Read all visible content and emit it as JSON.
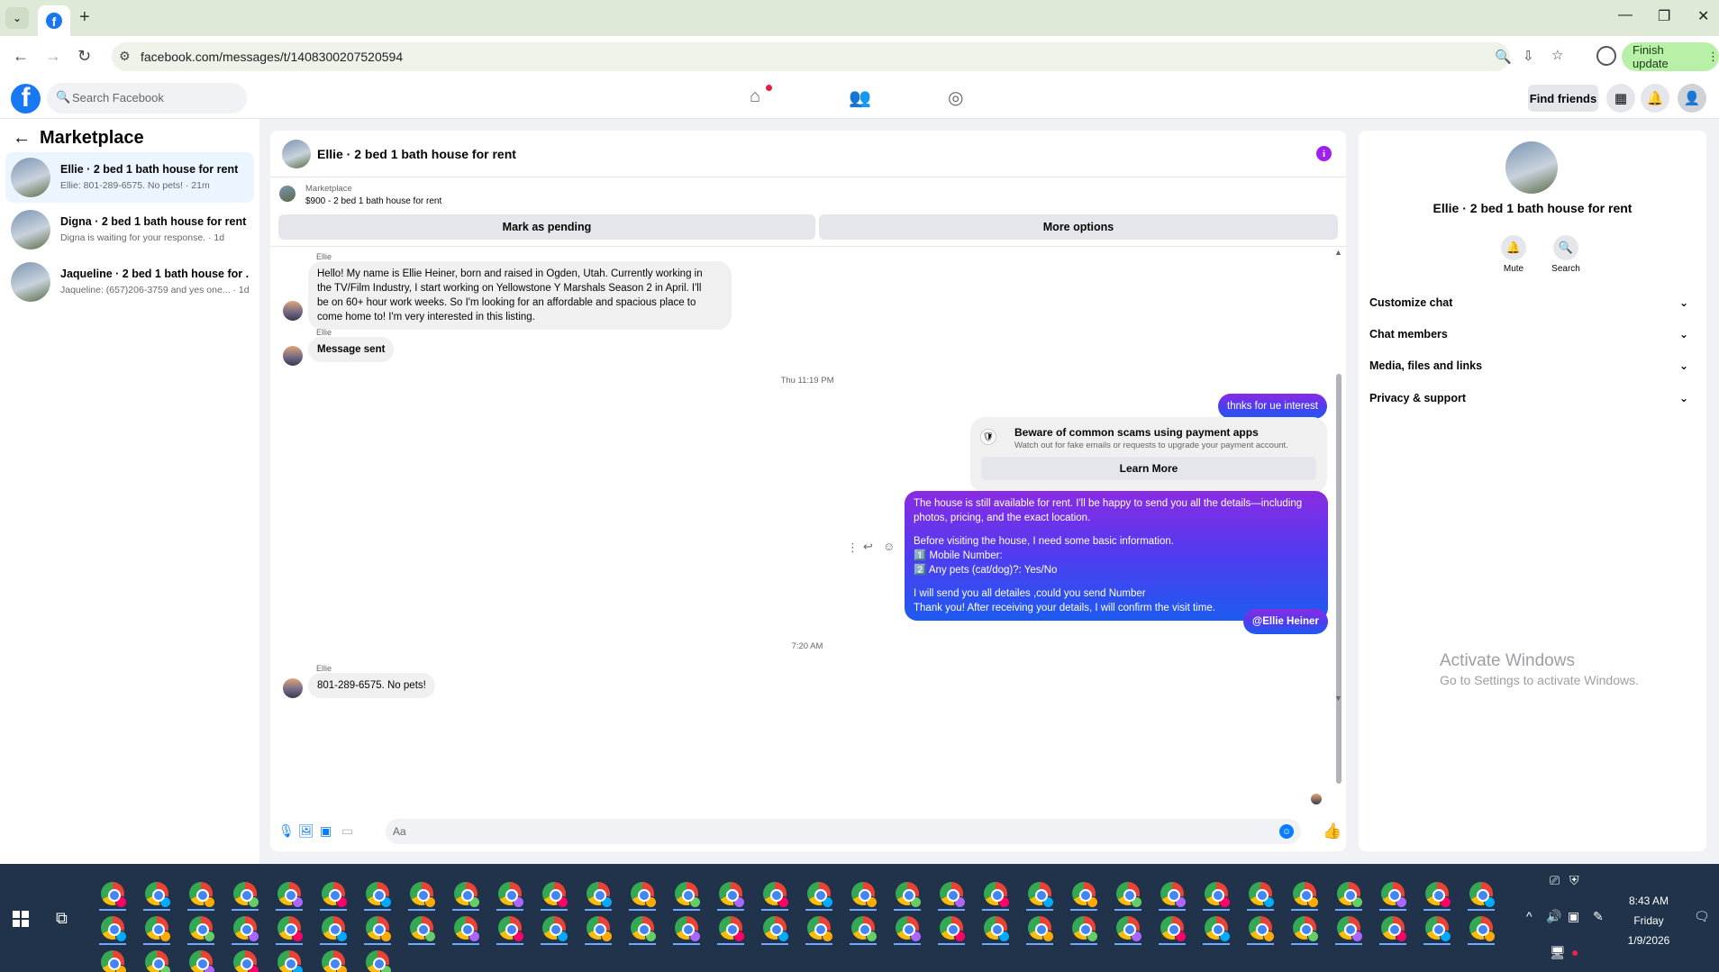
{
  "browser": {
    "tab_menu_icon": "chevron-down-icon",
    "new_tab_label": "+",
    "url": "facebook.com/messages/t/1408300207520594",
    "finish_update_label": "Finish update",
    "window_controls": [
      "—",
      "❐",
      "✕"
    ]
  },
  "fbnav": {
    "logo_letter": "f",
    "search_placeholder": "Search Facebook",
    "find_friends_label": "Find friends"
  },
  "left_panel": {
    "title": "Marketplace",
    "conversations": [
      {
        "name": "Ellie · 2 bed 1 bath house for rent",
        "preview": "Ellie: 801-289-6575. No pets! · 21m",
        "active": true
      },
      {
        "name": "Digna · 2 bed 1 bath house for rent",
        "preview": "Digna is waiting for your response. · 1d",
        "active": false
      },
      {
        "name": "Jaqueline · 2 bed 1 bath house for ...",
        "preview": "Jaqueline: (657)206-3759 and yes one... · 1d",
        "active": false
      }
    ]
  },
  "chat": {
    "title": "Ellie · 2 bed 1 bath house for rent",
    "info_icon_label": "i",
    "marketplace_label": "Marketplace",
    "listing_line": "$900 - 2 bed 1 bath house for rent",
    "mark_pending_label": "Mark as pending",
    "more_options_label": "More options",
    "messages": {
      "m1_sender": "Ellie",
      "m1_lines": [
        "Hello! My name is Ellie Heiner, born and raised in Ogden, Utah. Currently working in",
        "the TV/Film Industry, I start working on Yellowstone Y Marshals Season 2 in April. I'll",
        "be on 60+ hour work weeks. So I'm looking for an affordable and spacious place to",
        "come home to! I'm very interested in this listing."
      ],
      "m2_sender": "Ellie",
      "m2_text": "Message sent",
      "ts1": "Thu 11:19 PM",
      "out1": "thnks for ue interest",
      "warn_title": "Beware of common scams using payment apps",
      "warn_sub": "Watch out for fake emails or requests to upgrade your payment account.",
      "learn_more_label": "Learn More",
      "out2_lines": [
        "The house is still available for rent. I'll be happy to send you all the details—including",
        "photos, pricing, and the exact location.",
        "",
        "Before visiting the house, I need some basic information.",
        "1️⃣ Mobile Number:",
        "2️⃣ Any pets (cat/dog)?: Yes/No",
        "",
        "I will send you all detailes ,could you send Number",
        "Thank you! After receiving your details, I will confirm the visit time."
      ],
      "out3": "@Ellie Heiner",
      "ts2": "7:20 AM",
      "m3_sender": "Ellie",
      "m3_text": "801-289-6575. No pets!"
    },
    "composer_placeholder": "Aa"
  },
  "right_panel": {
    "name": "Ellie · 2 bed 1 bath house for rent",
    "mute_label": "Mute",
    "search_label": "Search",
    "sections": [
      "Customize chat",
      "Chat members",
      "Media, files and links",
      "Privacy & support"
    ],
    "watermark_title": "Activate Windows",
    "watermark_sub": "Go to Settings to activate Windows."
  },
  "taskbar": {
    "time": "8:43 AM",
    "day": "Friday",
    "date": "1/9/2026"
  },
  "colors": {
    "fb_blue": "#1877f2",
    "messenger_blue": "#0a7cff",
    "outgoing_gradient_top": "#8a2be2",
    "outgoing_gradient_bottom": "#1d5bf0",
    "taskbar": "#20334a"
  }
}
